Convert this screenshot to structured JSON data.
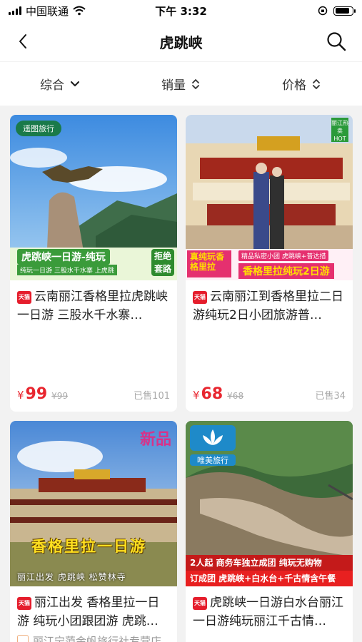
{
  "status_bar": {
    "carrier": "中国联通",
    "time": "下午 3:32",
    "battery_level": 0.85
  },
  "nav": {
    "title": "虎跳峡",
    "back_icon": "chevron-left-icon",
    "search_icon": "search-icon"
  },
  "filters": [
    {
      "label": "综合",
      "icon": "chevron-down-icon"
    },
    {
      "label": "销量",
      "icon": "sort-updown-icon"
    },
    {
      "label": "价格",
      "icon": "sort-updown-icon"
    }
  ],
  "colors": {
    "price": "#e8262f",
    "tmall": "#e51d2c"
  },
  "products": [
    {
      "badge": "天猫",
      "title": "云南丽江香格里拉虎跳峡一日游 三股水千水寨…",
      "price_symbol": "¥",
      "price": "99",
      "original_price": "¥99",
      "sold": "已售101",
      "image": {
        "logo": "遥图旅行",
        "banner_title": "虎跳峡一日游-纯玩",
        "banner_sub": "纯玩一日游  三股水千水寨  上虎跳",
        "banner_side": "拒绝套路"
      }
    },
    {
      "badge": "天猫",
      "title": "云南丽江到香格里拉二日游纯玩2日小团旅游普…",
      "price_symbol": "¥",
      "price": "68",
      "original_price": "¥68",
      "sold": "已售34",
      "image": {
        "hot": "丽江热卖HOT",
        "left_tag": "真纯玩香格里拉",
        "small_tag": "精品私密小团  虎跳峡+普达措",
        "big_tag": "香格里拉纯玩2日游"
      }
    },
    {
      "badge": "天猫",
      "title": "丽江出发 香格里拉一日游 纯玩小团跟团游  虎跳…",
      "shop": "丽江宁蒗金帆旅行社专营店",
      "image": {
        "new_tag": "新品",
        "title": "香格里拉一日游",
        "sub": "丽江出发    虎跳峡    松赞林寺"
      }
    },
    {
      "badge": "天猫",
      "title": "虎跳峡一日游白水台丽江一日游纯玩丽江千古情…",
      "image": {
        "logo": "唯美旅行",
        "line1": "2人起  商务车独立成团  纯玩无购物",
        "line2": "订成团 虎跳峡+白水台+千古情含午餐"
      }
    }
  ]
}
